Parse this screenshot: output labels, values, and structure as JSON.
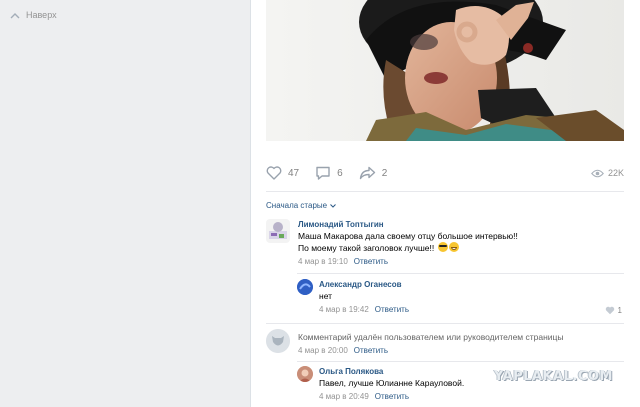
{
  "nav": {
    "up_label": "Наверх"
  },
  "post": {
    "likes": "47",
    "comments": "6",
    "shares": "2",
    "views": "22K"
  },
  "comments_sort": "Сначала старые",
  "comments": [
    {
      "author": "Лимонадий Топтыгин",
      "lines": [
        "Маша Макарова дала своему отцу большое интервью!!",
        "По моему такой заголовок лучше!!"
      ],
      "date": "4 мар в 19:10",
      "reply": "Ответить"
    },
    {
      "author": "Александр Оганесов",
      "lines": [
        "нет"
      ],
      "date": "4 мар в 19:42",
      "reply": "Ответить",
      "likes": "1"
    },
    {
      "author": "",
      "lines": [
        "Комментарий удалён пользователем или руководителем страницы"
      ],
      "date": "4 мар в 20:00",
      "reply": "Ответить"
    },
    {
      "author": "Ольга Полякова",
      "lines": [
        "Павел, лучше Юлианне Карауловой."
      ],
      "date": "4 мар в 20:49",
      "reply": "Ответить"
    }
  ],
  "watermark": "YAPLAKAL.COM",
  "colors": {
    "link": "#2a5885",
    "muted": "#939393",
    "page_bg": "#edeef0"
  }
}
